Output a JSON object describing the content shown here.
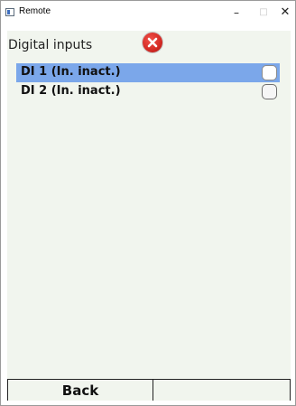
{
  "window": {
    "title": "Remote",
    "minimize_glyph": "–",
    "maximize_glyph": "□",
    "close_glyph": "✕"
  },
  "screen": {
    "title": "Digital inputs",
    "status_icon": "error-icon",
    "status_color": "#d42a24"
  },
  "inputs": [
    {
      "label": "DI 1 (In. inact.)",
      "checked": false,
      "selected": true
    },
    {
      "label": "DI 2 (In. inact.)",
      "checked": false,
      "selected": false
    }
  ],
  "softkeys": {
    "left": "Back",
    "right": ""
  },
  "colors": {
    "selection": "#7ba7ea",
    "background": "#f1f5ee"
  }
}
